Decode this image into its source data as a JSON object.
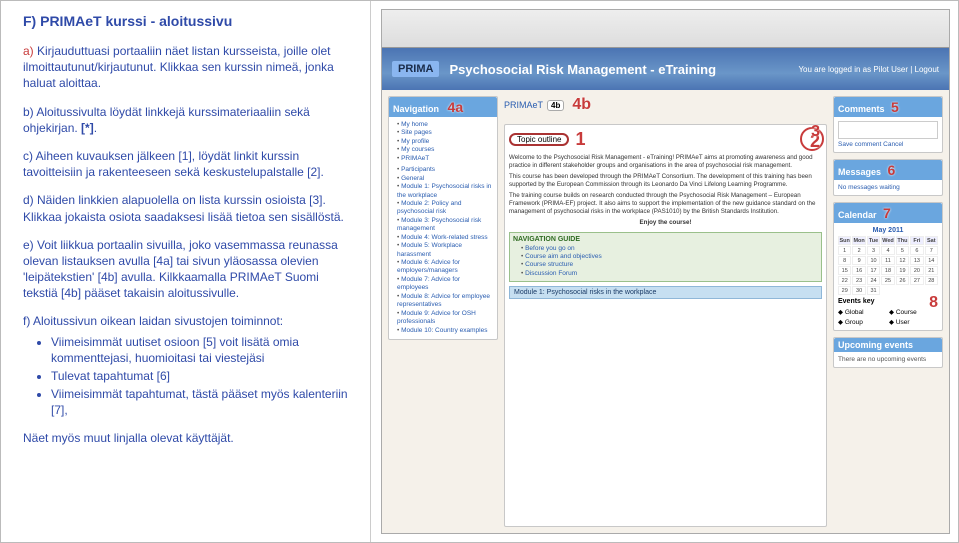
{
  "title": "F) PRIMAeT kurssi - aloitussivu",
  "para_a_lead": "a)",
  "para_a": " Kirjauduttuasi portaaliin näet listan kursseista, joille olet ilmoittautunut/kirjautunut. Klikkaa sen kurssin nimeä, jonka haluat aloittaa.",
  "para_b": "b) Aloitussivulta löydät linkkejä kurssimateriaaliin sekä ohjekirjan. ",
  "para_b_ref": "[*]",
  "para_c": "c) Aiheen kuvauksen jälkeen [1], löydät linkit kurssin tavoitteisiin ja rakenteeseen sekä keskustelupalstalle [2].",
  "para_d": "d) Näiden linkkien alapuolella on lista kurssin osioista [3]. Klikkaa jokaista osiota saadaksesi lisää tietoa sen sisällöstä.",
  "para_e": "e) Voit liikkua portaalin sivuilla, joko vasemmassa reunassa olevan listauksen avulla [4a] tai sivun yläosassa olevien 'leipätekstien' [4b] avulla. Kilkkaamalla PRIMAeT Suomi tekstiä [4b] pääset takaisin aloitussivulle.",
  "para_f_intro": "f) Aloitussivun oikean laidan sivustojen toiminnot:",
  "bullet1": "Viimeisimmät uutiset osioon [5] voit lisätä omia kommenttejasi, huomioitasi tai viestejäsi",
  "bullet2": "Tulevat tapahtumat [6]",
  "bullet3": "Viimeisimmät tapahtumat, tästä pääset myös kalenteriin [7],",
  "closing": "Näet myös muut linjalla olevat käyttäjät.",
  "banner_brand": "PRIMA",
  "banner_title": "Psychosocial Risk Management - eTraining",
  "banner_login": "You are logged in as Pilot User | Logout",
  "nav_head": "Navigation",
  "nav_items": [
    "My home",
    "Site pages",
    "My profile",
    "My courses",
    "PRIMAeT"
  ],
  "nav_sub": [
    "Participants",
    "General",
    "Module 1: Psychosocial risks in the workplace",
    "Module 2: Policy and psychosocial risk",
    "Module 3: Psychosocial risk management",
    "Module 4: Work-related stress",
    "Module 5: Workplace harassment",
    "Module 6: Advice for employers/managers",
    "Module 7: Advice for employees",
    "Module 8: Advice for employee representatives",
    "Module 9: Advice for OSH professionals",
    "Module 10: Country examples"
  ],
  "topic_breadcrumb": "PRIMAeT",
  "topic_badge": "4b",
  "topic_head": "Topic outline",
  "topic_num": "1",
  "mid_p1": "Welcome to the Psychosocial Risk Management - eTraining! PRIMAeT aims at promoting awareness and good practice in different stakeholder groups and organisations in the area of psychosocial risk management.",
  "mid_p2": "This course has been developed through the PRIMAeT Consortium. The development of this training has been supported by the European Commission through its Leonardo Da Vinci Lifelong Learning Programme.",
  "mid_p3": "The training course builds on research conducted through the Psychosocial Risk Management – European Framework (PRIMA-EF) project. It also aims to support the implementation of the new guidance standard on the management of psychosocial risks in the workplace (PAS1010) by the British Standards Institution.",
  "mid_enjoy": "Enjoy the course!",
  "guide_title": "NAVIGATION GUIDE",
  "guide_items": [
    "Before you go on",
    "Course aim and objectives",
    "Course structure",
    "Discussion Forum"
  ],
  "guide_num": "2",
  "mod1_row": "Module 1: Psychosocial risks in the workplace",
  "mod1_num": "3",
  "comments_head": "Comments",
  "comments_num": "5",
  "savecmt": "Save comment  Cancel",
  "messages_head": "Messages",
  "messages_num": "6",
  "messages_line": "No messages waiting",
  "calendar_head": "Calendar",
  "calendar_num": "7",
  "cal_month": "May 2011",
  "cal_days": [
    "Sun",
    "Mon",
    "Tue",
    "Wed",
    "Thu",
    "Fri",
    "Sat"
  ],
  "events_key_head": "Events key",
  "events_keys": [
    "Global",
    "Course",
    "Group",
    "User"
  ],
  "events_num": "8",
  "upcoming_head": "Upcoming events",
  "upcoming_text": "There are no upcoming events",
  "ann4a": "4a",
  "ann4b": "4b"
}
